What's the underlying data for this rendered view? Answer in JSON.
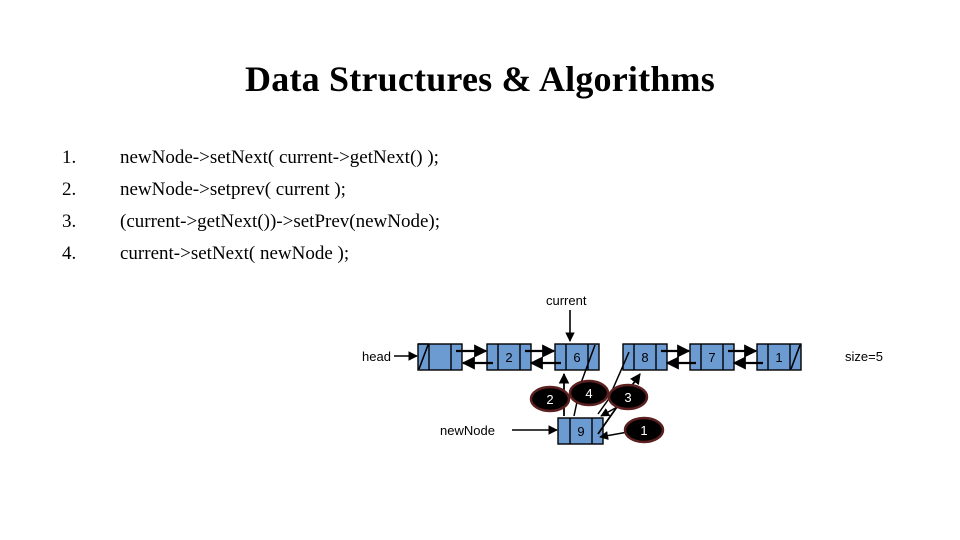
{
  "slide": {
    "title": "Data Structures & Algorithms",
    "background_color": "#ffffff",
    "text_color": "#000000"
  },
  "code_list": {
    "items": [
      {
        "number": "1.",
        "code": "newNode->setNext( current->getNext() );"
      },
      {
        "number": "2.",
        "code": "newNode->setprev( current );"
      },
      {
        "number": "3.",
        "code": "(current->getNext())->setPrev(newNode);"
      },
      {
        "number": "4.",
        "code": "current->setNext( newNode );"
      }
    ]
  },
  "diagram": {
    "type": "doubly-linked-list-insertion",
    "node_fill_color": "#6C9BD2",
    "node_border_color": "#000000",
    "marker_fill_color": "#000000",
    "marker_border_color": "#5C2020",
    "marker_text_color": "#ffffff",
    "labels": {
      "head": "head",
      "current": "current",
      "new_node": "newNode",
      "size": "size=5"
    },
    "list_nodes": [
      {
        "value": "",
        "prev_null": true,
        "next_null": false
      },
      {
        "value": "2",
        "prev_null": false,
        "next_null": false
      },
      {
        "value": "6",
        "prev_null": false,
        "next_null": false
      },
      {
        "value": "8",
        "prev_null": false,
        "next_null": false
      },
      {
        "value": "7",
        "prev_null": false,
        "next_null": false
      },
      {
        "value": "1",
        "prev_null": false,
        "next_null": true
      }
    ],
    "new_node": {
      "value": "9"
    },
    "step_markers": [
      {
        "label": "1",
        "meaning": "newNode->setNext( current->getNext() );"
      },
      {
        "label": "2",
        "meaning": "newNode->setprev( current );"
      },
      {
        "label": "3",
        "meaning": "(current->getNext())->setPrev(newNode);"
      },
      {
        "label": "4",
        "meaning": "current->setNext( newNode );"
      }
    ],
    "size_value": "5"
  }
}
